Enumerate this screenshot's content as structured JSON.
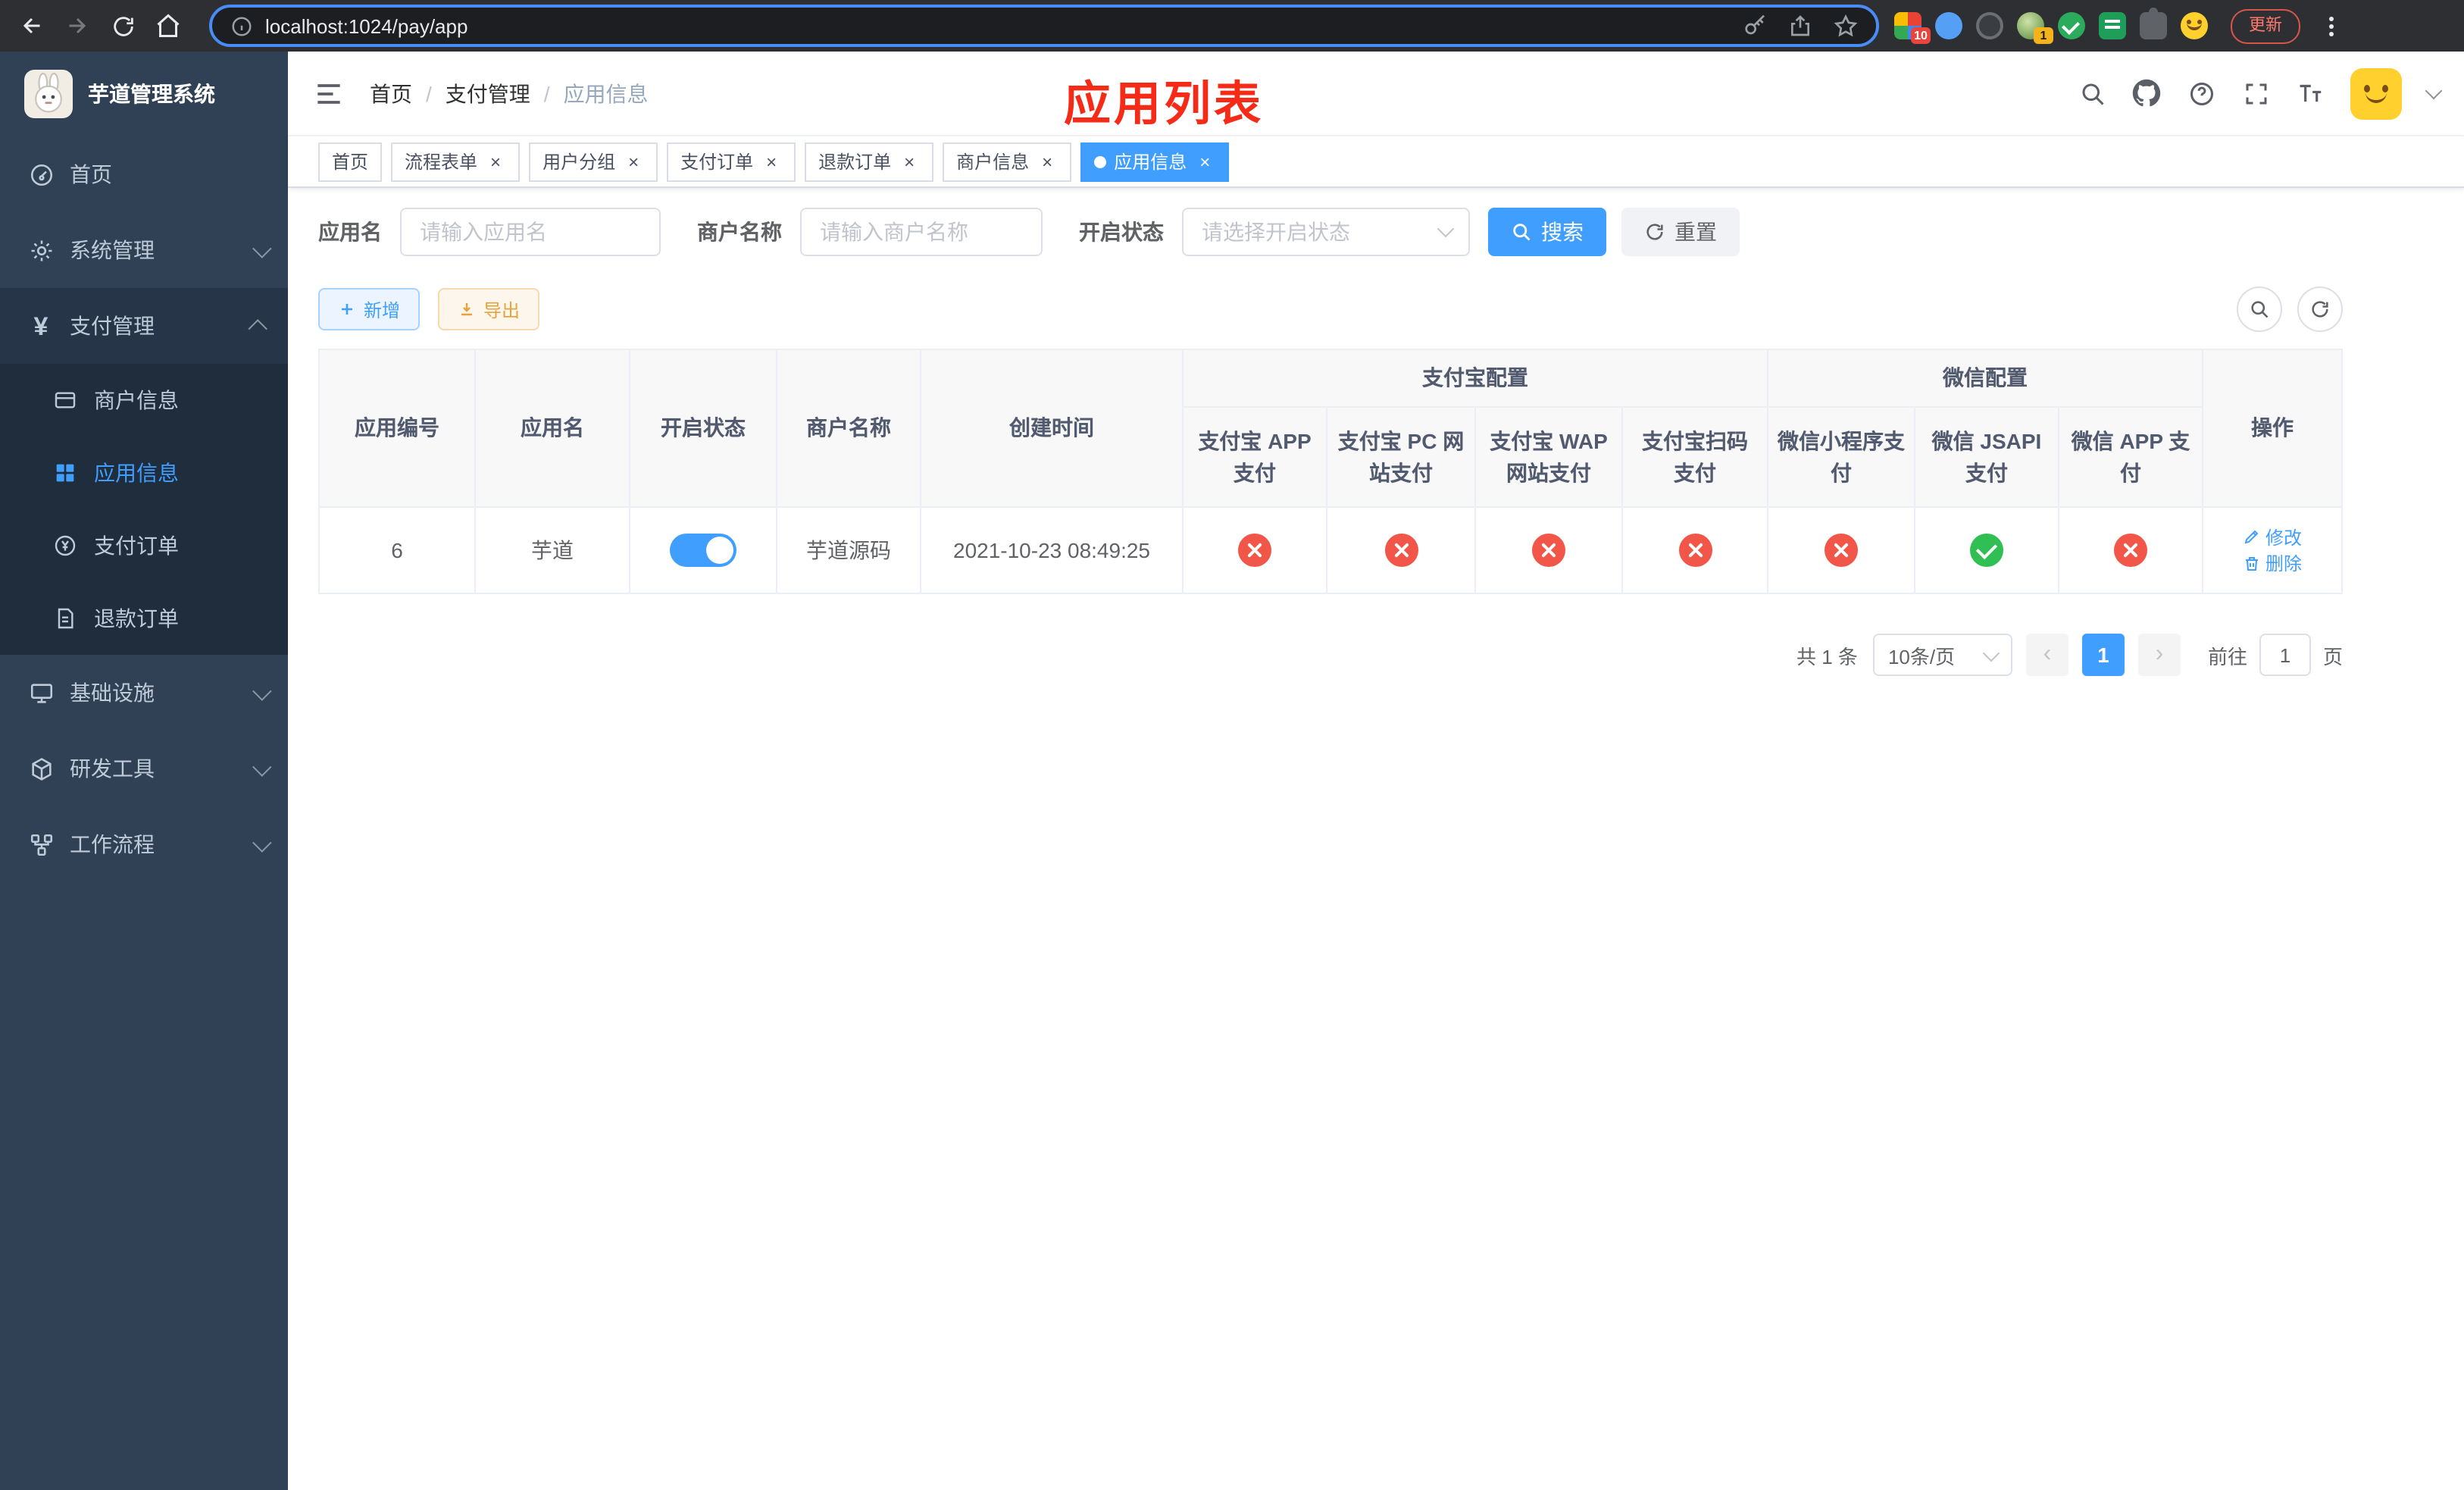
{
  "browser": {
    "url": "localhost:1024/pay/app",
    "update_button": "更新",
    "extension_badge_count": "10",
    "avatar_badge_count": "1"
  },
  "sidebar": {
    "app_title": "芋道管理系统",
    "items": [
      {
        "label": "首页",
        "icon": "dashboard-icon"
      },
      {
        "label": "系统管理",
        "icon": "gear-icon"
      },
      {
        "label": "支付管理",
        "icon": "yen-icon"
      },
      {
        "label": "基础设施",
        "icon": "infrastructure-icon"
      },
      {
        "label": "研发工具",
        "icon": "dev-tools-icon"
      },
      {
        "label": "工作流程",
        "icon": "workflow-icon"
      }
    ],
    "payment_children": [
      {
        "label": "商户信息",
        "icon": "merchant-icon"
      },
      {
        "label": "应用信息",
        "icon": "app-grid-icon"
      },
      {
        "label": "支付订单",
        "icon": "pay-order-icon"
      },
      {
        "label": "退款订单",
        "icon": "refund-order-icon"
      }
    ]
  },
  "header": {
    "breadcrumb": [
      "首页",
      "支付管理",
      "应用信息"
    ],
    "overlay_title": "应用列表"
  },
  "tabs": [
    {
      "label": "首页"
    },
    {
      "label": "流程表单"
    },
    {
      "label": "用户分组"
    },
    {
      "label": "支付订单"
    },
    {
      "label": "退款订单"
    },
    {
      "label": "商户信息"
    },
    {
      "label": "应用信息"
    }
  ],
  "filters": {
    "app_name_label": "应用名",
    "app_name_placeholder": "请输入应用名",
    "merchant_name_label": "商户名称",
    "merchant_name_placeholder": "请输入商户名称",
    "status_label": "开启状态",
    "status_placeholder": "请选择开启状态",
    "search_button": "搜索",
    "reset_button": "重置"
  },
  "toolbar": {
    "add_button": "新增",
    "export_button": "导出"
  },
  "table": {
    "headers": {
      "app_id": "应用编号",
      "app_name": "应用名",
      "status": "开启状态",
      "merchant_name": "商户名称",
      "create_time": "创建时间",
      "alipay_group": "支付宝配置",
      "wechat_group": "微信配置",
      "config_columns": [
        "支付宝 APP 支付",
        "支付宝 PC 网站支付",
        "支付宝 WAP 网站支付",
        "支付宝扫码支付",
        "微信小程序支付",
        "微信 JSAPI 支付",
        "微信 APP 支付"
      ],
      "actions": "操作"
    },
    "row": {
      "app_id": "6",
      "app_name": "芋道",
      "status_on": true,
      "merchant_name": "芋道源码",
      "create_time": "2021-10-23 08:49:25",
      "configs": [
        false,
        false,
        false,
        false,
        false,
        true,
        false
      ],
      "edit_action": "修改",
      "delete_action": "删除"
    }
  },
  "pagination": {
    "total_text": "共 1 条",
    "page_size": "10条/页",
    "current_page": "1",
    "goto_prefix": "前往",
    "goto_value": "1",
    "goto_suffix": "页"
  },
  "colors": {
    "primary": "#409eff",
    "danger": "#f25649",
    "success": "#2fbf53",
    "overlay_title_red": "#f62b17"
  }
}
